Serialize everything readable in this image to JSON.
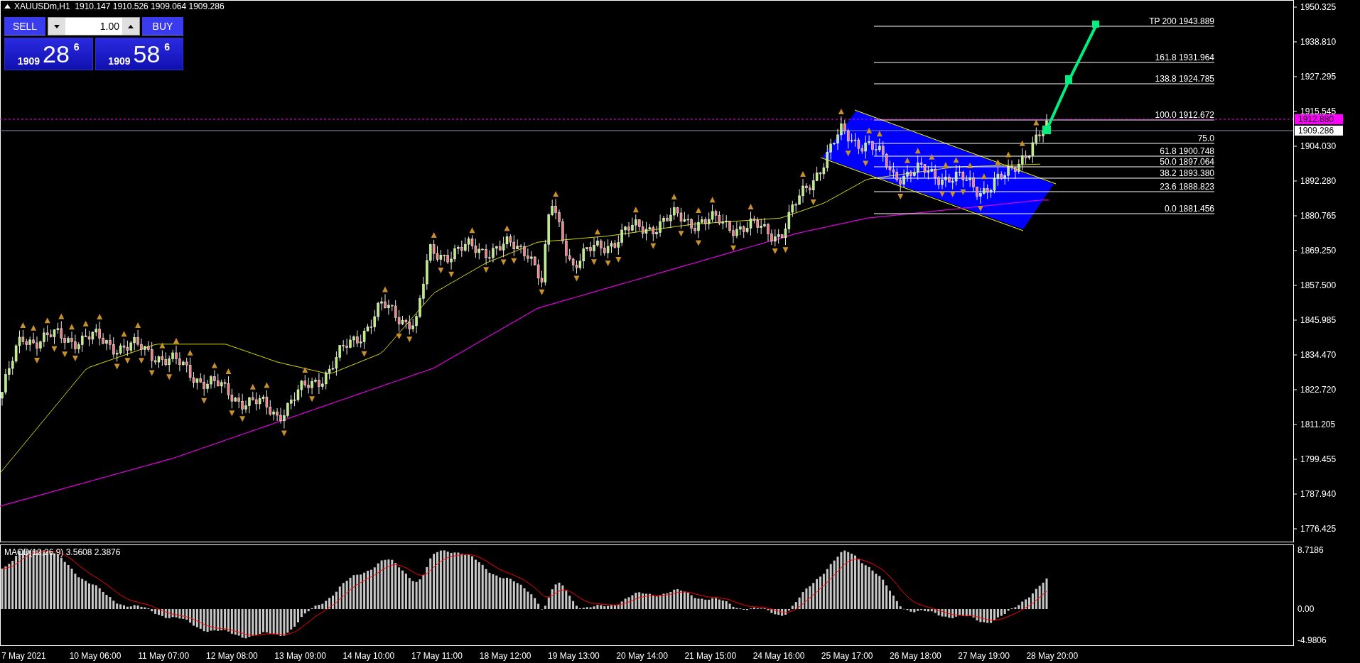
{
  "chart_header": {
    "symbol_info": "XAUUSDm,H1  1910.147 1910.526 1909.064 1909.286"
  },
  "one_click_trading": {
    "sell_label": "SELL",
    "buy_label": "BUY",
    "volume": "1.00",
    "sell_quote": {
      "prefix": "1909",
      "pips": "28",
      "fraction": "6"
    },
    "buy_quote": {
      "prefix": "1909",
      "pips": "58",
      "fraction": "6"
    }
  },
  "price_axis": {
    "labels": [
      "1950.325",
      "1938.810",
      "1927.295",
      "1915.545",
      "1904.030",
      "1892.280",
      "1880.765",
      "1869.250",
      "1857.500",
      "1845.985",
      "1834.470",
      "1822.720",
      "1811.205",
      "1799.455",
      "1787.940",
      "1776.425"
    ],
    "ask_marker": "1912.880",
    "bid_marker": "1909.286"
  },
  "fibonacci_levels": [
    {
      "label": "TP 200 1943.889"
    },
    {
      "label": "161.8 1931.964"
    },
    {
      "label": "138.8 1924.785"
    },
    {
      "label": "100.0 1912.672"
    },
    {
      "label": "75.0"
    },
    {
      "label": "61.8 1900.748"
    },
    {
      "label": "50.0 1897.064"
    },
    {
      "label": "38.2 1893.380"
    },
    {
      "label": "23.6 1888.823"
    },
    {
      "label": "0.0 1881.456"
    }
  ],
  "macd": {
    "label": "MACD(12,26,9) 3.5608 2.3876",
    "axis_labels": [
      "8.7186",
      "0.00",
      "-4.9806"
    ]
  },
  "time_axis": [
    "7 May 2021",
    "10 May 06:00",
    "11 May 07:00",
    "12 May 08:00",
    "13 May 09:00",
    "14 May 10:00",
    "17 May 11:00",
    "18 May 12:00",
    "19 May 13:00",
    "20 May 14:00",
    "21 May 15:00",
    "24 May 16:00",
    "25 May 17:00",
    "26 May 18:00",
    "27 May 19:00",
    "28 May 20:00"
  ]
}
